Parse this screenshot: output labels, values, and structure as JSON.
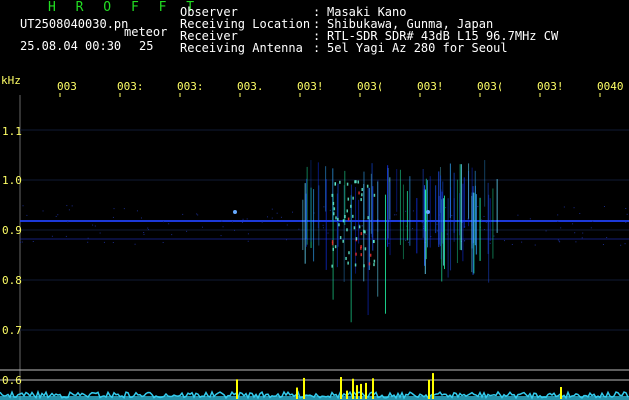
{
  "header": {
    "title": "H R O F F T",
    "filename": "UT2508040030.pn",
    "meteor_label": "meteor",
    "datetime": "25.08.04 00:30",
    "meteor_count": "25"
  },
  "metadata": [
    {
      "label": "Observer",
      "value": "Masaki Kano"
    },
    {
      "label": "Receiving Location",
      "value": "Shibukawa, Gunma, Japan"
    },
    {
      "label": "Receiver",
      "value": "RTL-SDR SDR# 43dB L15 96.7MHz CW"
    },
    {
      "label": "Receiving Antenna",
      "value": "5el Yagi Az 280 for Seoul"
    }
  ],
  "colon": ":",
  "axis": {
    "y_unit": "kHz",
    "y_ticks": [
      "1.1",
      "1.0",
      "0.9",
      "0.8",
      "0.7",
      "0.6"
    ],
    "x_ticks": [
      "003",
      "003:",
      "003:",
      "003.",
      "003!",
      "003(",
      "003!",
      "003(",
      "003!",
      "0040"
    ]
  },
  "colors": {
    "background": "#000000",
    "title": "#22dd22",
    "axis_labels": "#ffff66",
    "grid": "#ffffff",
    "signal_bar": "#ffff00",
    "noise_floor": "#33ccee"
  }
}
